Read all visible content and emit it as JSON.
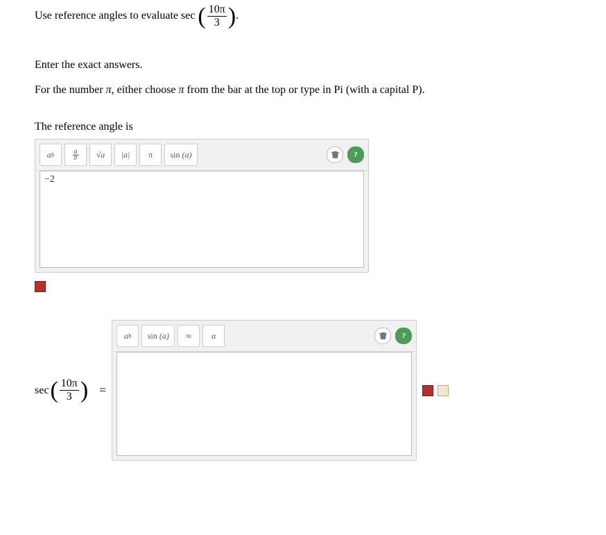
{
  "prompt_lead": "Use reference angles to evaluate sec",
  "prompt_arg_num": "10π",
  "prompt_arg_den": "3",
  "prompt_trail": ".",
  "instr1": "Enter the exact answers.",
  "instr2_pre": "For the number ",
  "instr2_pi": "π",
  "instr2_mid": ", either choose ",
  "instr2_pi2": "π",
  "instr2_post": " from the bar at the top or type in Pi (with a capital P).",
  "ref_angle_label": "The reference angle is",
  "editor1": {
    "value": "−2"
  },
  "editor2": {
    "value": ""
  },
  "tools": {
    "power": "a",
    "power_sup": "b",
    "frac_num": "a",
    "frac_den": "b",
    "sqrt": "√a",
    "abs": "|a|",
    "pi": "π",
    "sin": "sin (a)",
    "infty": "∞",
    "alpha": "α",
    "trash": "🗑",
    "help": "?"
  },
  "sec_label": "sec",
  "sec_arg_num": "10π",
  "sec_arg_den": "3",
  "equals": "="
}
